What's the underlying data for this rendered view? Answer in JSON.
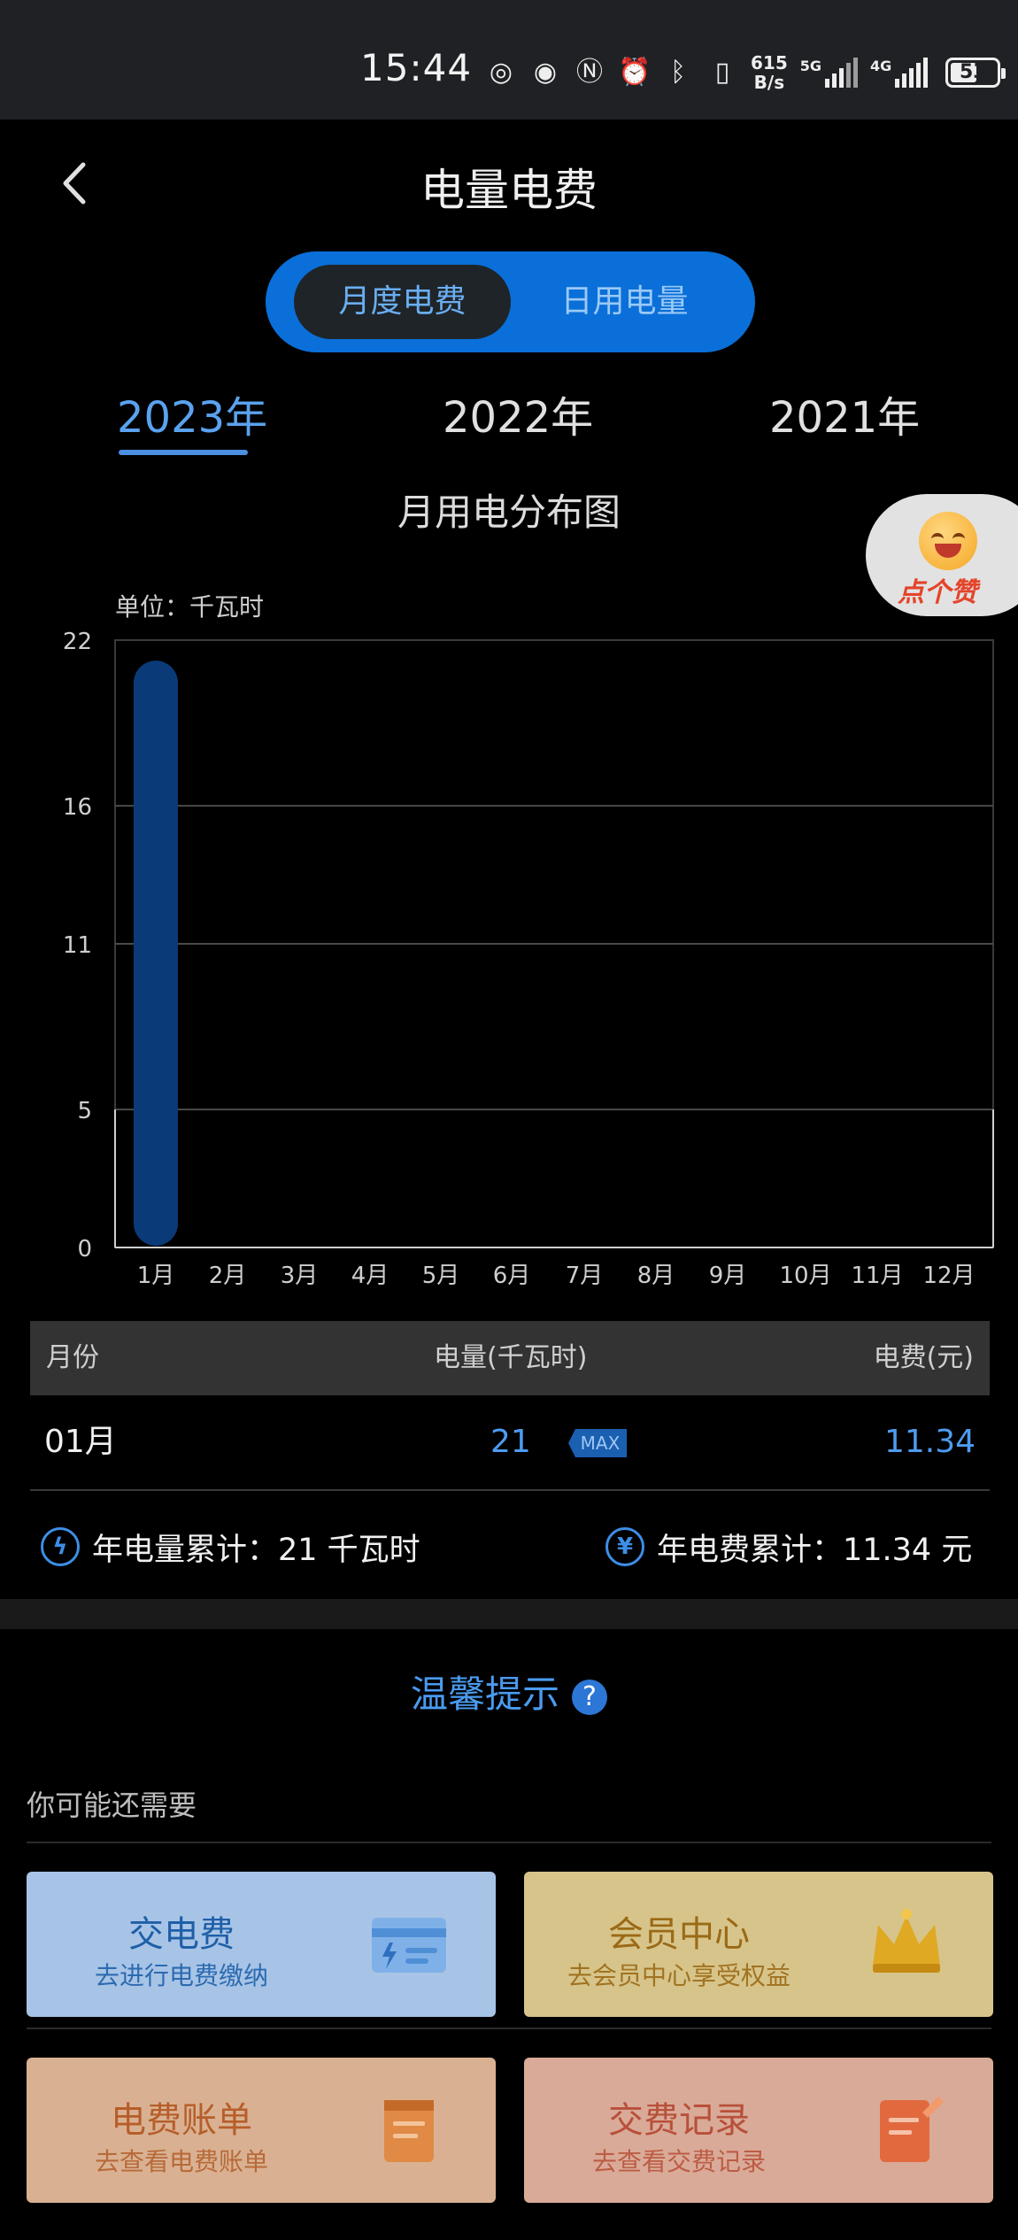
{
  "status_bar": {
    "time": "15:44",
    "net_speed": "615\nB/s",
    "sig1_label": "5G",
    "sig2_label": "4G",
    "battery": "53"
  },
  "header": {
    "title": "电量电费"
  },
  "segment": {
    "monthly": "月度电费",
    "daily": "日用电量"
  },
  "years": [
    "2023年",
    "2022年",
    "2021年"
  ],
  "chart_title": "月用电分布图",
  "unit_label": "单位：千瓦时",
  "like_label": "点个赞",
  "chart_data": {
    "type": "bar",
    "categories": [
      "1月",
      "2月",
      "3月",
      "4月",
      "5月",
      "6月",
      "7月",
      "8月",
      "9月",
      "10月",
      "11月",
      "12月"
    ],
    "values": [
      21,
      null,
      null,
      null,
      null,
      null,
      null,
      null,
      null,
      null,
      null,
      null
    ],
    "yticks": [
      0,
      5,
      11,
      16,
      22
    ],
    "ylim": [
      0,
      22
    ],
    "bar_color": "#0b3a78",
    "grid": true
  },
  "table": {
    "headers": {
      "month": "月份",
      "kwh": "电量(千瓦时)",
      "fee": "电费(元)"
    },
    "rows": [
      {
        "month": "01月",
        "kwh": "21",
        "badge": "MAX",
        "fee": "11.34"
      }
    ]
  },
  "summary": {
    "kwh_icon": "bolt-icon",
    "kwh_text": "年电量累计：21 千瓦时",
    "fee_icon": "yuan-icon",
    "fee_text": "年电费累计：11.34 元"
  },
  "tips": {
    "title": "温馨提示",
    "q": "?"
  },
  "need_label": "你可能还需要",
  "cards": [
    {
      "title": "交电费",
      "sub": "去进行电费缴纳",
      "icon": "payment-card-icon"
    },
    {
      "title": "会员中心",
      "sub": "去会员中心享受权益",
      "icon": "crown-icon"
    },
    {
      "title": "电费账单",
      "sub": "去查看电费账单",
      "icon": "bill-icon"
    },
    {
      "title": "交费记录",
      "sub": "去查看交费记录",
      "icon": "record-icon"
    }
  ],
  "colors": {
    "accent": "#0a6fd8",
    "link_blue": "#5aa2ee",
    "bar": "#0b3a78"
  }
}
